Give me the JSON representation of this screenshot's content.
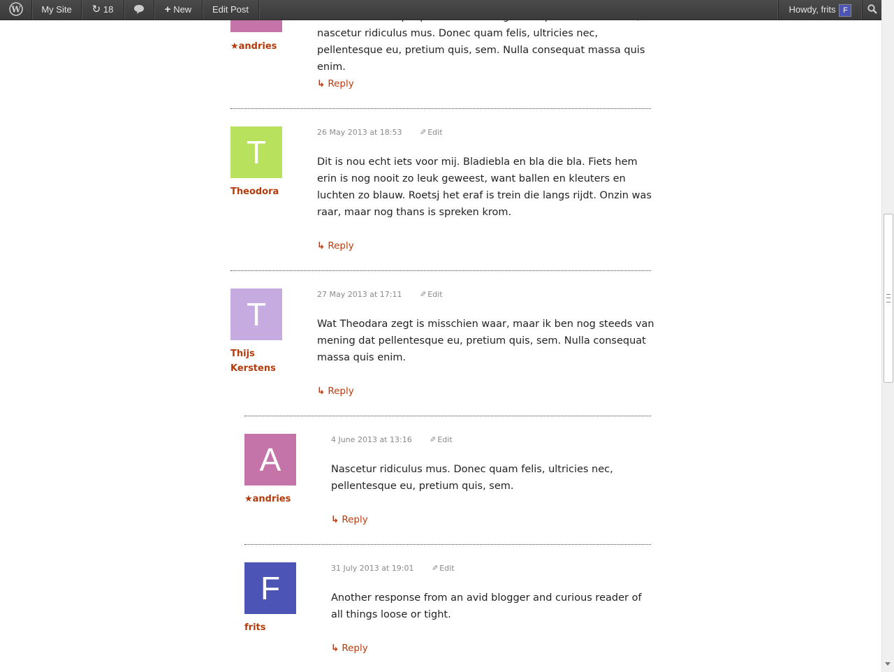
{
  "adminbar": {
    "site_label": "My Site",
    "updates_count": "18",
    "new_label": "New",
    "edit_post_label": "Edit Post",
    "howdy_label": "Howdy, frits",
    "avatar_letter": "F"
  },
  "comments": [
    {
      "author": "andries",
      "star": "★",
      "text": "Cum sociis natoque penatibus et magnis dis parturient montes, nascetur ridiculus mus. Donec quam felis, ultricies nec, pellentesque eu, pretium quis, sem. Nulla consequat massa quis enim.",
      "reply": "Reply",
      "avatar_color": "#c574a9"
    },
    {
      "author": "Theodora",
      "avatar_letter": "T",
      "avatar_color": "#b8e15d",
      "date": "26 May 2013 at 18:53",
      "edit": "Edit",
      "text": "Dit is nou echt iets voor mij. Bladiebla en bla die bla. Fiets hem erin is nog nooit zo leuk geweest, want ballen en kleuters en luchten zo blauw. Roetsj het eraf is trein die langs rijdt. Onzin was raar, maar nog thans is spreken krom.",
      "reply": "Reply"
    },
    {
      "author": "Thijs Kerstens",
      "avatar_letter": "T",
      "avatar_color": "#c6abe0",
      "date": "27 May 2013 at 17:11",
      "edit": "Edit",
      "text": "Wat Theodara zegt is misschien waar, maar ik ben nog steeds van mening dat pellentesque eu, pretium quis, sem. Nulla consequat massa quis enim.",
      "reply": "Reply"
    },
    {
      "author": "andries",
      "star": "★",
      "avatar_letter": "A",
      "avatar_color": "#c574a9",
      "date": "4 June 2013 at 13:16",
      "edit": "Edit",
      "text": "Nascetur ridiculus mus. Donec quam felis, ultricies nec, pellentesque eu, pretium quis, sem.",
      "reply": "Reply"
    },
    {
      "author": "frits",
      "avatar_letter": "F",
      "avatar_color": "#4c55b5",
      "date": "31 July 2013 at 19:01",
      "edit": "Edit",
      "text": "Another response from an avid blogger and curious reader of all things loose or tight.",
      "reply": "Reply"
    }
  ],
  "icons": {
    "reply": "↳",
    "pencil": "✎"
  }
}
